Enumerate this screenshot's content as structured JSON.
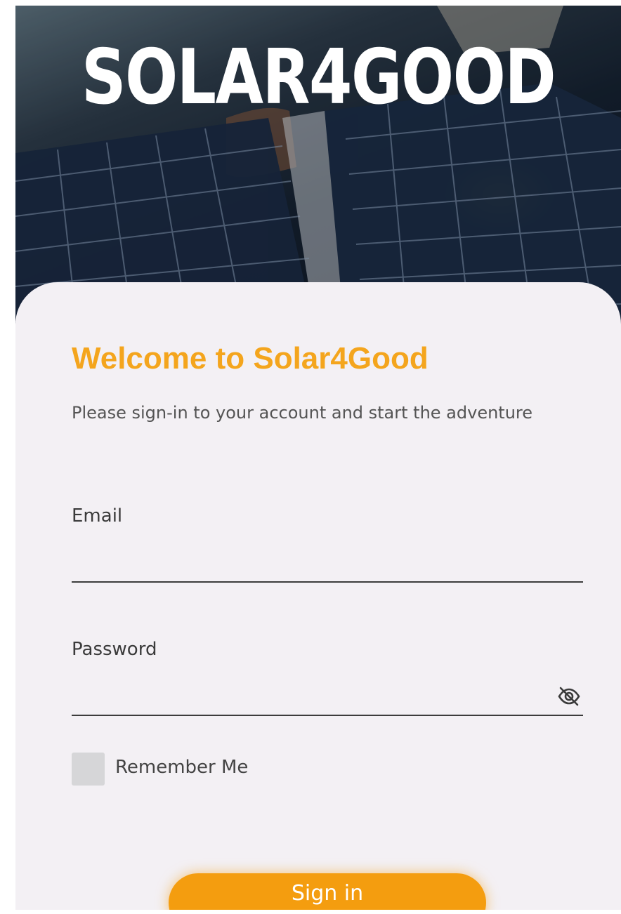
{
  "brand": {
    "logo_text": "SOLAR4GOOD",
    "accent_color": "#f4a51d",
    "button_color": "#f49d0f"
  },
  "login": {
    "title": "Welcome to Solar4Good",
    "subtitle": "Please sign-in to your account and start the adventure",
    "email_label": "Email",
    "email_value": "",
    "password_label": "Password",
    "password_value": "",
    "password_toggle_icon": "eye-off-icon",
    "remember_label": "Remember Me",
    "remember_checked": false,
    "submit_label": "Sign in"
  }
}
